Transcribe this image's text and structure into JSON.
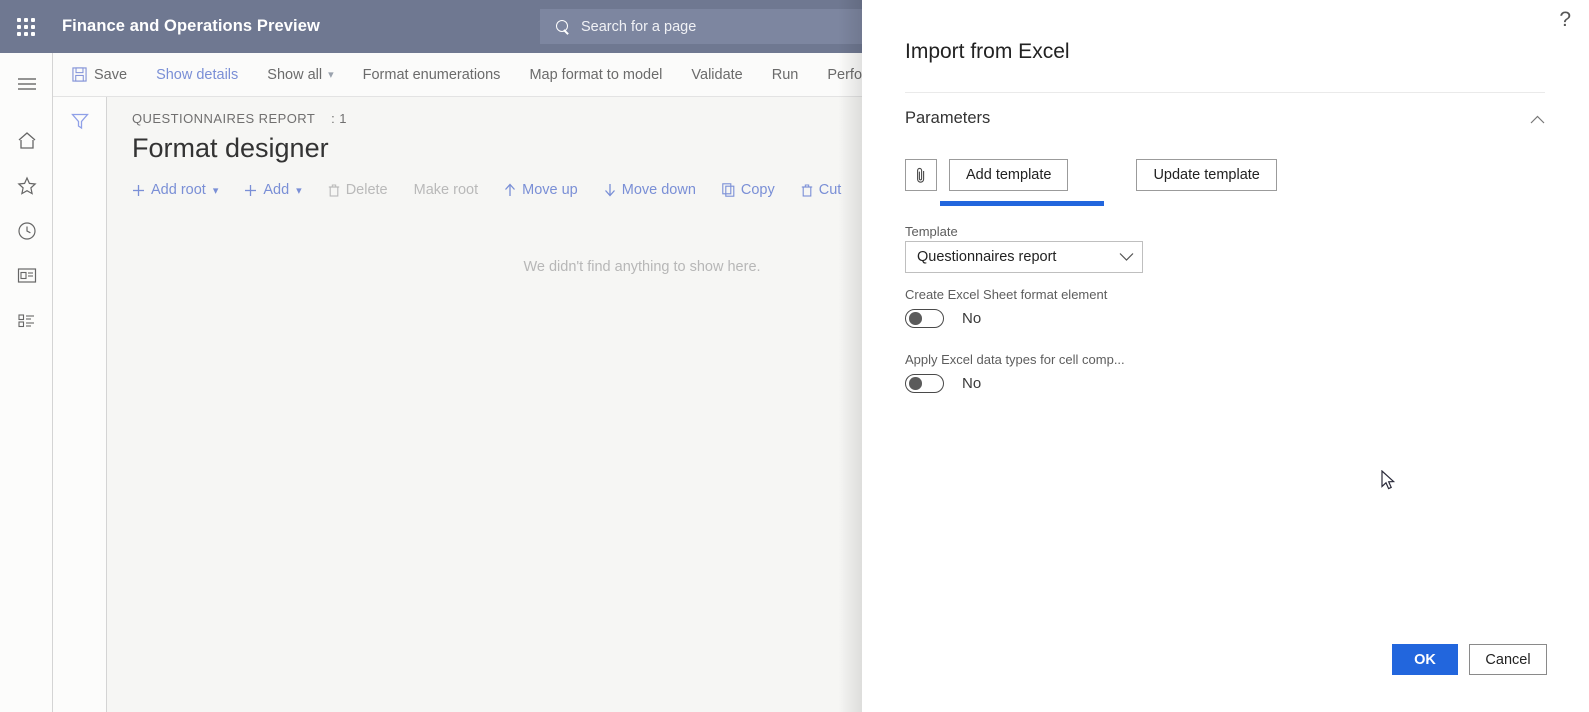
{
  "header": {
    "waffle_icon": "app-launcher-icon",
    "title": "Finance and Operations Preview",
    "search_placeholder": "Search for a page",
    "search_icon": "search-icon"
  },
  "nav_rail": {
    "items": [
      {
        "name": "hamburger-menu",
        "icon": "hamburger-icon"
      },
      {
        "name": "home",
        "icon": "home-icon"
      },
      {
        "name": "favorites",
        "icon": "star-icon"
      },
      {
        "name": "recent",
        "icon": "clock-icon"
      },
      {
        "name": "workspaces",
        "icon": "workspace-icon"
      },
      {
        "name": "modules",
        "icon": "list-icon"
      }
    ]
  },
  "toolbar": {
    "items": [
      {
        "label": "Save",
        "icon": "save-icon",
        "style": "default"
      },
      {
        "label": "Show details",
        "style": "link"
      },
      {
        "label": "Show all",
        "style": "default",
        "chevron": true
      },
      {
        "label": "Format enumerations",
        "style": "default"
      },
      {
        "label": "Map format to model",
        "style": "default"
      },
      {
        "label": "Validate",
        "style": "default"
      },
      {
        "label": "Run",
        "style": "default"
      },
      {
        "label": "Perfo",
        "style": "default"
      }
    ]
  },
  "filter_strip": {
    "icon": "filter-funnel-icon"
  },
  "content": {
    "breadcrumb": "QUESTIONNAIRES REPORT",
    "breadcrumb_count": ": 1",
    "page_title": "Format designer",
    "actions": [
      {
        "label": "Add root",
        "icon": "plus-icon",
        "chevron": true,
        "disabled": false
      },
      {
        "label": "Add",
        "icon": "plus-icon",
        "chevron": true,
        "disabled": false
      },
      {
        "label": "Delete",
        "icon": "trash-icon",
        "chevron": false,
        "disabled": true
      },
      {
        "label": "Make root",
        "icon": "",
        "chevron": false,
        "disabled": true
      },
      {
        "label": "Move up",
        "icon": "arrow-up-icon",
        "chevron": false,
        "disabled": false
      },
      {
        "label": "Move down",
        "icon": "arrow-down-icon",
        "chevron": false,
        "disabled": false
      },
      {
        "label": "Copy",
        "icon": "copy-icon",
        "chevron": false,
        "disabled": false
      },
      {
        "label": "Cut",
        "icon": "trash-icon",
        "chevron": false,
        "disabled": false
      }
    ],
    "empty_message": "We didn't find anything to show here."
  },
  "panel": {
    "help_icon": "?",
    "title": "Import from Excel",
    "section": {
      "label": "Parameters",
      "collapse_caret": "⌃"
    },
    "attach_button_icon": "paperclip-icon",
    "add_template_label": "Add template",
    "update_template_label": "Update template",
    "template_field": {
      "label": "Template",
      "value": "Questionnaires report",
      "chevron_icon": "chevron-down-icon"
    },
    "create_sheet_toggle": {
      "label": "Create Excel Sheet format element",
      "value": "No",
      "checked": false
    },
    "apply_types_toggle": {
      "label": "Apply Excel data types for cell comp...",
      "value": "No",
      "checked": false
    },
    "ok_label": "OK",
    "cancel_label": "Cancel"
  },
  "colors": {
    "header_bg": "#6f7891",
    "accent_blue": "#2266dd",
    "link_blue": "#7a8fd6",
    "content_bg": "#f6f6f4"
  }
}
